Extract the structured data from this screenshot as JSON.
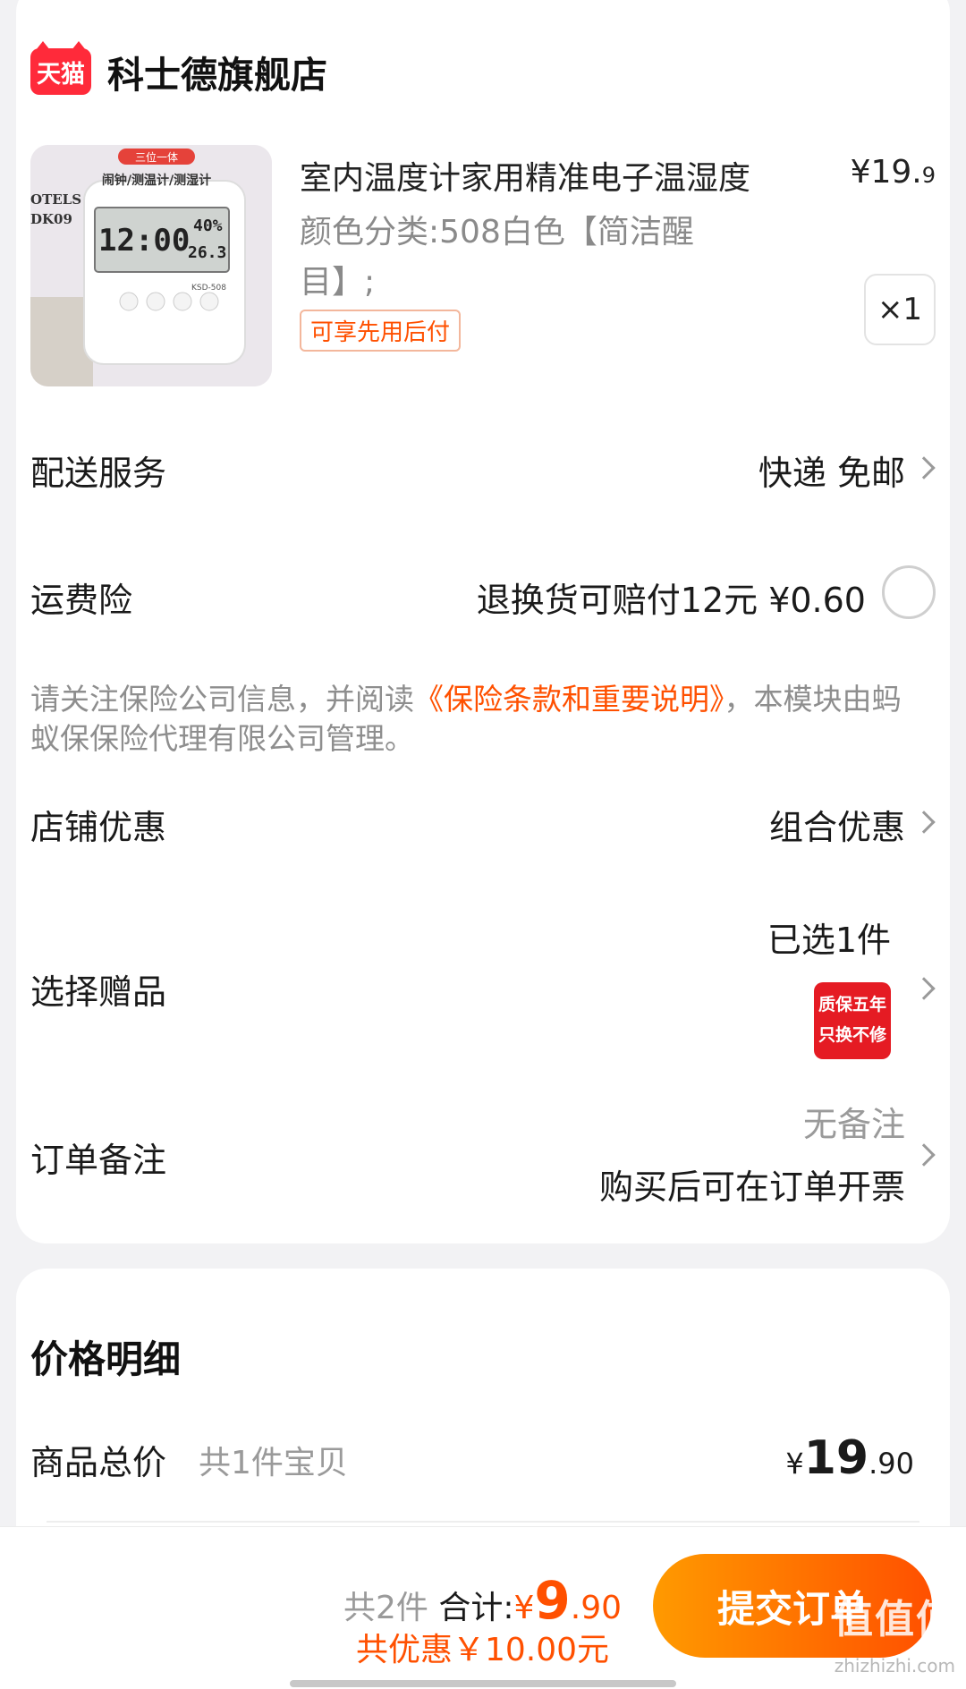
{
  "store": {
    "badge": "天猫",
    "name": "科士德旗舰店"
  },
  "product": {
    "title": "室内温度计家用精准电子温湿度",
    "price_prefix": "¥19.",
    "price_suffix": "9",
    "sku": "颜色分类:508白色【简洁醒目】;",
    "pay_later": "可享先用后付",
    "quantity": "×1",
    "image_texts": {
      "top_banner": "三位一体",
      "subtitle": "闹钟/测温计/测湿计",
      "time": "12:00",
      "humidity": "40%",
      "temperature": "26.3",
      "model": "KSD-508",
      "book_text_1": "OTELS",
      "book_text_2": "DK09"
    }
  },
  "rows": {
    "delivery": {
      "label": "配送服务",
      "value": "快递 免邮"
    },
    "freight_insurance": {
      "label": "运费险",
      "value": "退换货可赔付12元 ¥0.60"
    },
    "insurance_note": {
      "prefix": "请关注保险公司信息，并阅读",
      "link": "《保险条款和重要说明》",
      "suffix": "，本模块由蚂蚁保保险代理有限公司管理。"
    },
    "shop_discount": {
      "label": "店铺优惠",
      "value": "组合优惠"
    },
    "gift": {
      "label": "选择赠品",
      "value": "已选1件",
      "badge_line1": "质保五年",
      "badge_line2": "只换不修"
    },
    "remark": {
      "label": "订单备注",
      "value": "无备注",
      "value2": "购买后可在订单开票"
    }
  },
  "price_detail": {
    "title": "价格明细",
    "total_label": "商品总价",
    "total_sub": "共1件宝贝",
    "total_currency": "¥",
    "total_big": "19",
    "total_small": ".90"
  },
  "bottom_bar": {
    "count": "共2件",
    "sum_label": "合计:",
    "sum_currency": "¥",
    "sum_big": "9",
    "sum_small": ".90",
    "discount": "共优惠￥10.00元",
    "submit": "提交订单"
  },
  "watermark": {
    "text": "值值值",
    "url": "zhizhizhi.com"
  },
  "colors": {
    "accent": "#ff5000",
    "tmall_red": "#ff2a3a",
    "button_gradient_start": "#ff9a00",
    "button_gradient_end": "#ff5000"
  }
}
